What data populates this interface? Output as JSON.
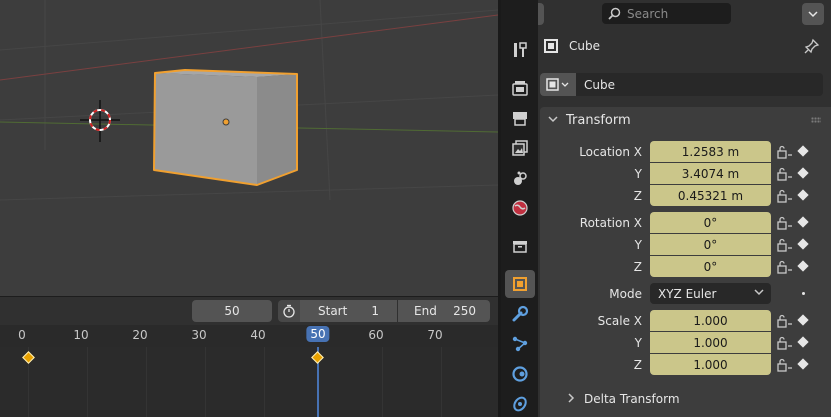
{
  "viewport": {
    "object_name": "Cube"
  },
  "timeline": {
    "current_frame": "50",
    "start_label": "Start",
    "start_value": "1",
    "end_label": "End",
    "end_value": "250",
    "ruler_ticks": [
      "0",
      "10",
      "20",
      "30",
      "40",
      "50",
      "60",
      "70"
    ],
    "keyframes": [
      0,
      50
    ],
    "colors": {
      "playhead": "#4772b3",
      "keyframe": "#e8a100"
    }
  },
  "properties_header": {
    "search_placeholder": "Search"
  },
  "object": {
    "name": "Cube",
    "datablock_name": "Cube"
  },
  "transform": {
    "title": "Transform",
    "location": {
      "label_x": "Location X",
      "label_y": "Y",
      "label_z": "Z",
      "x": "1.2583 m",
      "y": "3.4074 m",
      "z": "0.45321 m"
    },
    "rotation": {
      "label_x": "Rotation X",
      "label_y": "Y",
      "label_z": "Z",
      "x": "0°",
      "y": "0°",
      "z": "0°"
    },
    "mode": {
      "label": "Mode",
      "value": "XYZ Euler"
    },
    "scale": {
      "label_x": "Scale X",
      "label_y": "Y",
      "label_z": "Z",
      "x": "1.000",
      "y": "1.000",
      "z": "1.000"
    }
  },
  "delta_transform": {
    "title": "Delta Transform"
  },
  "tabs": [
    "tool-icon",
    "render-icon",
    "output-icon",
    "view-layer-icon",
    "scene-icon",
    "world-icon",
    "collection-icon",
    "object-icon",
    "modifier-icon",
    "particles-icon",
    "physics-icon",
    "constraints-icon"
  ],
  "colors": {
    "selection_outline": "#f0a030",
    "animated_field": "#cbc68a",
    "active_tab": "#545454"
  }
}
